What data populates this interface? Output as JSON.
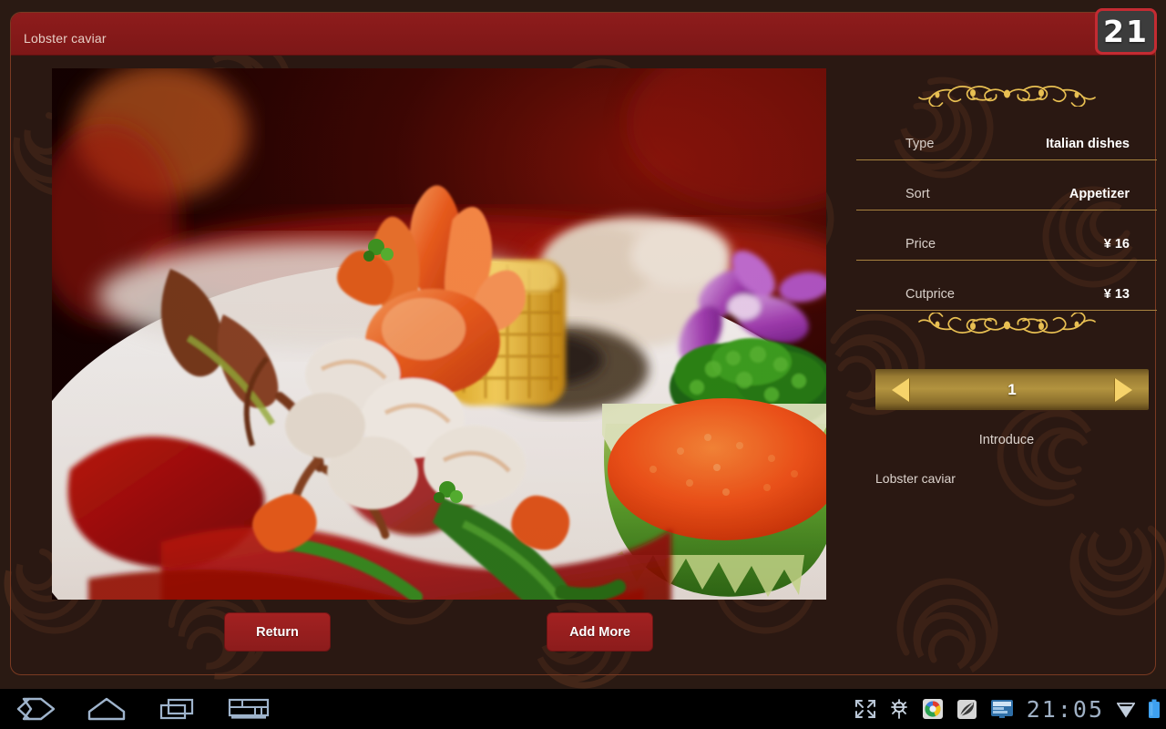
{
  "titlebar": {
    "title": "Lobster caviar",
    "badge_count": "21",
    "bg": "#8e1c1c",
    "badge_border": "#c42b32"
  },
  "photo": {
    "alt": "Lobster caviar plated dish with shrimp, corn, broccoli and orange caviar in a carved melon bowl"
  },
  "buttons": {
    "return": "Return",
    "add_more": "Add More"
  },
  "panel": {
    "rows": [
      {
        "label": "Type",
        "value": "Italian dishes"
      },
      {
        "label": "Sort",
        "value": "Appetizer"
      },
      {
        "label": "Price",
        "value": "¥ 16"
      },
      {
        "label": "Cutprice",
        "value": "¥ 13"
      }
    ],
    "pager": {
      "page": "1",
      "prev_icon": "triangle-left-icon",
      "next_icon": "triangle-right-icon"
    },
    "introduce_title": "Introduce",
    "introduce_body": "Lobster caviar",
    "divider_color": "#a8833f",
    "accent_gold": "#f6d36a"
  },
  "navbar": {
    "back": "back-icon",
    "home": "home-icon",
    "recents": "recents-icon",
    "keyboard": "keyboard-icon",
    "fullscreen": "fullscreen-icon",
    "usb": "usb-debug-icon",
    "browser": "browser-icon",
    "leaf": "leaf-icon",
    "screenshot": "screenshot-icon",
    "time": "21:05",
    "wifi": "wifi-icon",
    "battery": "battery-icon"
  }
}
